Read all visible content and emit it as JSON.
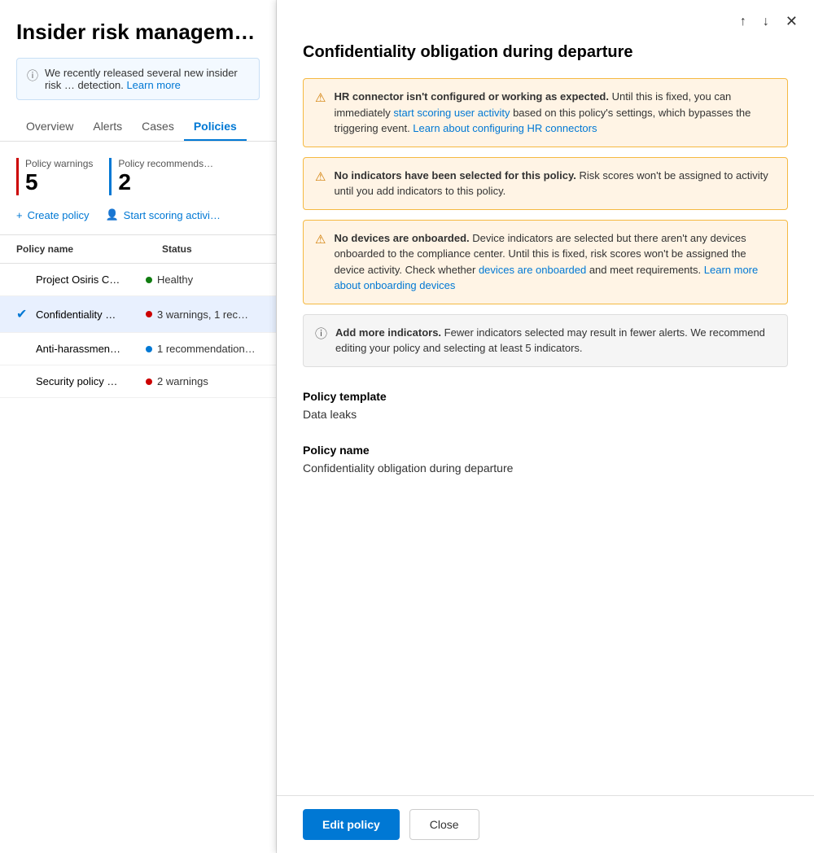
{
  "left": {
    "page_title": "Insider risk managem…",
    "banner": {
      "text": "We recently released several new insider risk …",
      "link": "Learn more"
    },
    "nav_tabs": [
      {
        "label": "Overview",
        "active": false
      },
      {
        "label": "Alerts",
        "active": false
      },
      {
        "label": "Cases",
        "active": false
      },
      {
        "label": "Policies",
        "active": true
      }
    ],
    "stats": [
      {
        "label": "Policy warnings",
        "value": "5",
        "color": "red"
      },
      {
        "label": "Policy recommends…",
        "value": "2",
        "color": "blue"
      }
    ],
    "actions": [
      {
        "label": "Create policy",
        "icon": "+"
      },
      {
        "label": "Start scoring activi…",
        "icon": "👤"
      }
    ],
    "table_headers": [
      "Policy name",
      "Status"
    ],
    "rows": [
      {
        "name": "Project Osiris C…",
        "status": "Healthy",
        "dot": "green",
        "extra": "",
        "selected": false,
        "checked": false
      },
      {
        "name": "Confidentiality …",
        "status": "3 warnings, 1 rec…",
        "dot": "red",
        "extra": "",
        "selected": true,
        "checked": true
      },
      {
        "name": "Anti-harassmen…",
        "status": "1 recommendation…",
        "dot": "blue",
        "extra": "",
        "selected": false,
        "checked": false
      },
      {
        "name": "Security policy …",
        "status": "2 warnings",
        "dot": "red",
        "extra": "",
        "selected": false,
        "checked": false
      }
    ]
  },
  "drawer": {
    "title": "Confidentiality obligation during departure",
    "nav_up_label": "↑",
    "nav_down_label": "↓",
    "close_label": "✕",
    "alerts": [
      {
        "type": "warning",
        "bold": "HR connector isn't configured or working as expected.",
        "text_before": "",
        "link1_text": "start scoring user activity",
        "text_middle": " based on this policy's settings, which bypasses the triggering event. ",
        "link2_text": "Learn about configuring HR connectors",
        "text_after": ""
      },
      {
        "type": "warning",
        "bold": "No indicators have been selected for this policy.",
        "text": " Risk scores won't be assigned to activity until you add indicators to this policy."
      },
      {
        "type": "warning",
        "bold": "No devices are onboarded.",
        "text_before": " Device indicators are selected but there aren't any devices onboarded to the compliance center. Until this is fixed, risk scores won't be assigned the device activity. Check whether ",
        "link1_text": "devices are onboarded",
        "text_middle": " and meet requirements. ",
        "link2_text": "Learn more about onboarding devices",
        "text_after": ""
      },
      {
        "type": "info",
        "bold": "Add more indicators.",
        "text": " Fewer indicators selected may result in fewer alerts. We recommend editing your policy and selecting at least 5 indicators."
      }
    ],
    "sections": [
      {
        "label": "Policy template",
        "value": "Data leaks"
      },
      {
        "label": "Policy name",
        "value": "Confidentiality obligation during departure"
      }
    ],
    "footer_buttons": [
      {
        "label": "Edit policy",
        "type": "primary"
      },
      {
        "label": "Close",
        "type": "secondary"
      }
    ]
  }
}
